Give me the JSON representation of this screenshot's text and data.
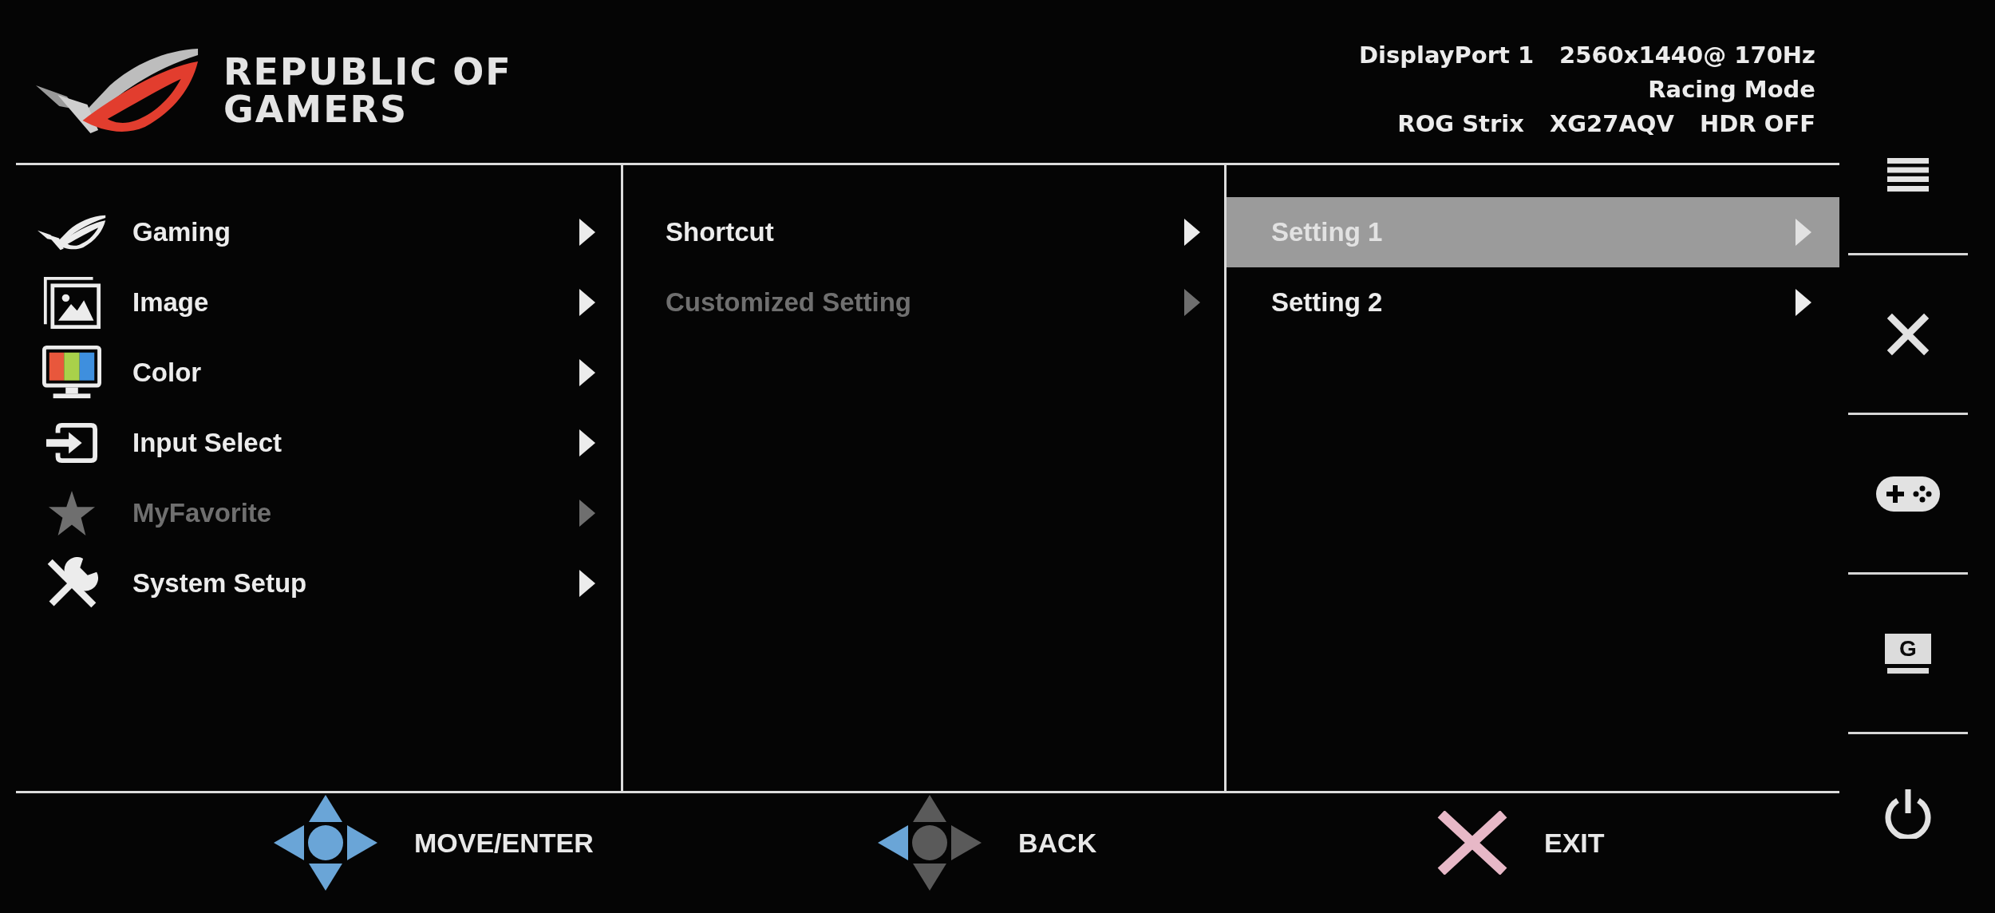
{
  "header": {
    "brand": [
      "REPUBLIC OF",
      "GAMERS"
    ],
    "status_lines": [
      [
        "DisplayPort 1",
        "2560x1440@ 170Hz"
      ],
      [
        "Racing Mode"
      ],
      [
        "ROG Strix",
        "XG27AQV",
        "HDR OFF"
      ]
    ]
  },
  "main_menu": [
    {
      "kind": "gaming",
      "label": "Gaming",
      "dimmed": false
    },
    {
      "kind": "image",
      "label": "Image",
      "dimmed": false
    },
    {
      "kind": "color",
      "label": "Color",
      "dimmed": false
    },
    {
      "kind": "input",
      "label": "Input Select",
      "dimmed": false
    },
    {
      "kind": "favorite",
      "label": "MyFavorite",
      "dimmed": true
    },
    {
      "kind": "system",
      "label": "System Setup",
      "dimmed": false
    }
  ],
  "submenu": [
    {
      "label": "Shortcut",
      "dimmed": false
    },
    {
      "label": "Customized Setting",
      "dimmed": true
    }
  ],
  "options": [
    {
      "label": "Setting 1",
      "selected": true
    },
    {
      "label": "Setting 2",
      "selected": false
    }
  ],
  "side_buttons": [
    {
      "kind": "menu"
    },
    {
      "kind": "close"
    },
    {
      "kind": "gamepad"
    },
    {
      "kind": "letter",
      "glyph": "G"
    },
    {
      "kind": "power"
    }
  ],
  "key_hints": [
    {
      "kind": "move",
      "label": "MOVE/ENTER"
    },
    {
      "kind": "back",
      "label": "BACK"
    },
    {
      "kind": "exit",
      "label": "EXIT"
    }
  ]
}
